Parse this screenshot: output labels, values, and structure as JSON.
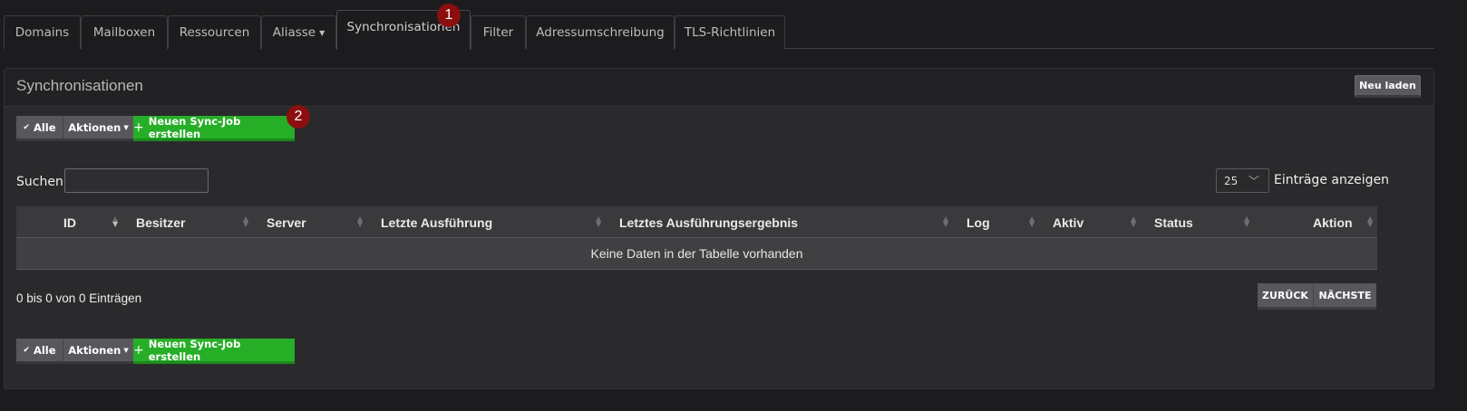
{
  "tabs": [
    {
      "label": "Domains",
      "active": false
    },
    {
      "label": "Mailboxen",
      "active": false
    },
    {
      "label": "Ressourcen",
      "active": false
    },
    {
      "label": "Aliasse",
      "active": false,
      "dropdown": true
    },
    {
      "label": "Synchronisationen",
      "active": true
    },
    {
      "label": "Filter",
      "active": false
    },
    {
      "label": "Adressumschreibung",
      "active": false
    },
    {
      "label": "TLS-Richtlinien",
      "active": false
    }
  ],
  "badges": [
    "1",
    "2"
  ],
  "panel": {
    "title": "Synchronisationen",
    "reload_label": "Neu laden"
  },
  "toolbar": {
    "all_label": "Alle",
    "actions_label": "Aktionen",
    "create_label": "Neuen Sync-Job erstellen"
  },
  "search": {
    "label": "Suchen",
    "value": ""
  },
  "page_length": {
    "value": "25",
    "label": "Einträge anzeigen"
  },
  "table": {
    "columns": [
      "ID",
      "Besitzer",
      "Server",
      "Letzte Ausführung",
      "Letztes Ausführungsergebnis",
      "Log",
      "Aktiv",
      "Status",
      "Aktion"
    ],
    "empty_message": "Keine Daten in der Tabelle vorhanden"
  },
  "info_text": "0 bis 0 von 0 Einträgen",
  "pager": {
    "prev_label": "ZURÜCK",
    "next_label": "NÄCHSTE"
  },
  "colors": {
    "background": "#1c1c1e",
    "panel": "#2a2a2c",
    "accent_green": "#27ae27",
    "badge_red": "#8b0f0f"
  },
  "icons": {
    "all": "check-all-icon",
    "actions": "caret-down-icon",
    "create": "plus-icon",
    "select": "chevron-down-icon"
  }
}
